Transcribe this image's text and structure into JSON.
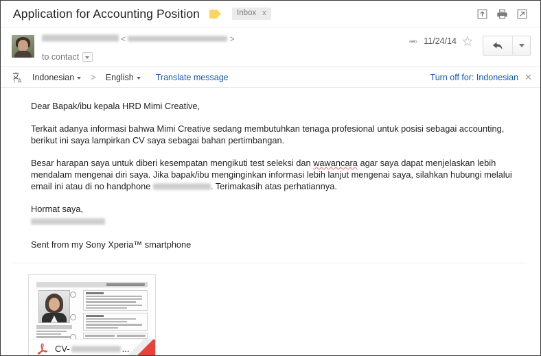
{
  "header": {
    "subject": "Application for Accounting Position",
    "label_tag_icon": "label-tag-icon",
    "inbox_chip": "Inbox",
    "inbox_chip_close": "x",
    "icons": [
      {
        "name": "move-to-inbox-icon",
        "title": "Move to Inbox"
      },
      {
        "name": "print-icon",
        "title": "Print"
      },
      {
        "name": "open-in-new-window-icon",
        "title": "Open in new window"
      }
    ]
  },
  "sender": {
    "avatar_name": "avatar",
    "name_redacted": true,
    "email_open_bracket": "<",
    "email_close_bracket": ">",
    "to_label": "to contact",
    "attachment_indicator_icon": "paperclip-icon",
    "date": "11/24/14",
    "star_icon": "star-outline-icon",
    "reply_icon": "reply-arrow-icon",
    "more_icon": "chevron-down-icon"
  },
  "translate": {
    "icon": "translate-icon",
    "source_language": "Indonesian",
    "arrow": ">",
    "target_language": "English",
    "translate_link": "Translate message",
    "turn_off_label": "Turn off for: Indonesian",
    "close": "✕",
    "link_color": "#1155cc"
  },
  "body": {
    "greeting": "Dear Bapak/ibu kepala HRD Mimi Creative,",
    "paragraph_1_part_a": "Terkait adanya informasi bahwa Mimi Creative sedang membutuhkan tenaga profesional untuk posisi sebagai accounting, berikut ini saya lampirkan CV saya sebagai bahan pertimbangan.",
    "paragraph_2_part_a": "Besar harapan saya untuk diberi kesempatan mengikuti test seleksi dan ",
    "paragraph_2_misspelled": "wawancara",
    "paragraph_2_part_b": " agar saya dapat menjelaskan lebih mendalam mengenai diri saya. Jika bapak/ibu menginginkan informasi lebih lanjut mengenai saya, silahkan hubungi melalui email ini atau di no handphone ",
    "paragraph_2_part_c": ". Terimakasih atas perhatiannya.",
    "closing": "Hormat saya,",
    "signature_redacted": true,
    "sent_from": "Sent from my Sony Xperia™ smartphone"
  },
  "attachment": {
    "thumbnail_alt": "CV preview page",
    "file_icon": "pdf-icon",
    "filename_prefix": "CV-",
    "filename_redacted": true,
    "filename_suffix": "..."
  }
}
